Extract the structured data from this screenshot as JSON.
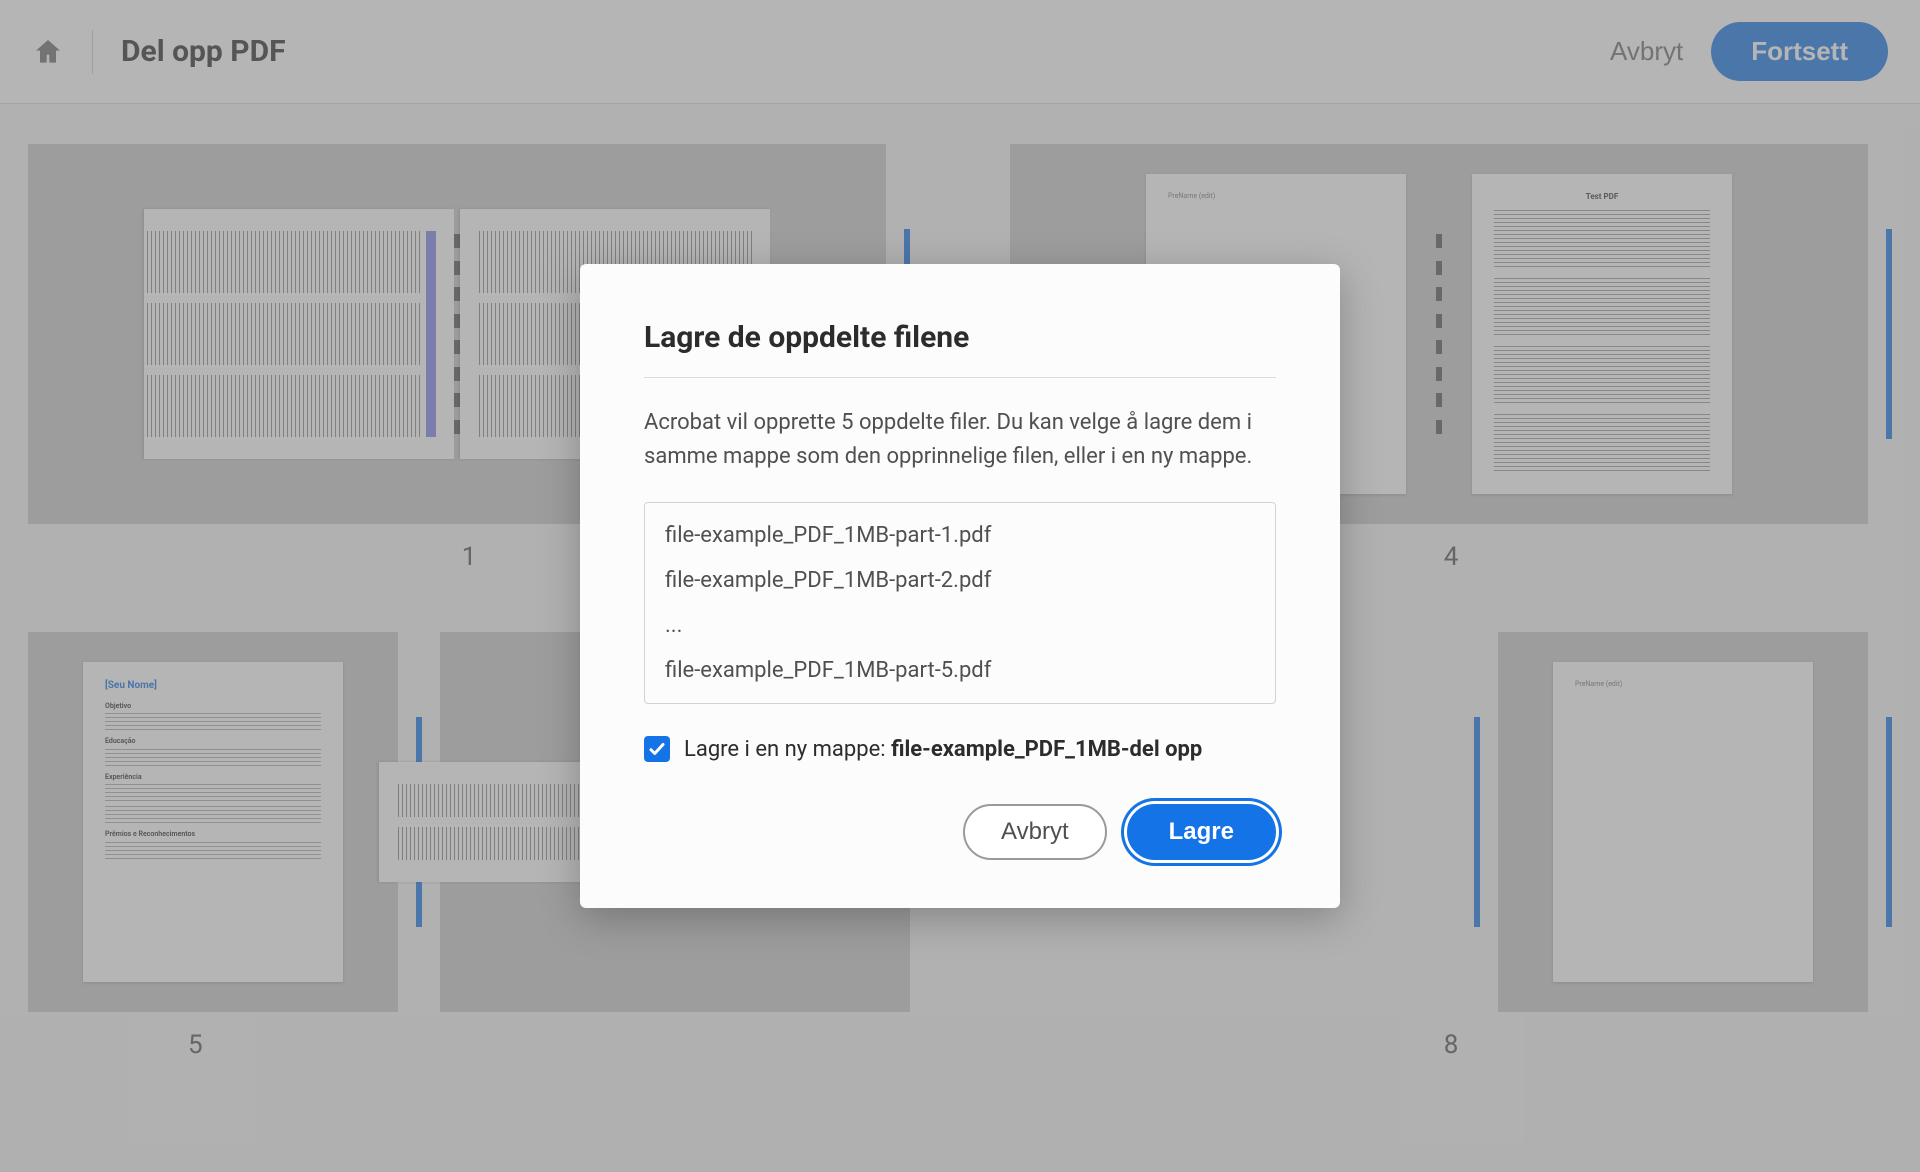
{
  "header": {
    "title": "Del opp PDF",
    "cancel": "Avbryt",
    "continue": "Fortsett"
  },
  "pages": {
    "p1": "1",
    "p4": "4",
    "p5": "5",
    "p8": "8"
  },
  "thumb": {
    "seu_nome": "[Seu Nome]",
    "objetivo": "Objetivo",
    "educacao": "Educação",
    "experiencia": "Experiência",
    "premios": "Prêmios e Reconhecimentos",
    "test_pdf": "Test PDF",
    "prename": "PreName (edit)"
  },
  "modal": {
    "title": "Lagre de oppdelte filene",
    "description": "Acrobat vil opprette 5 oppdelte filer. Du kan velge å lagre dem i samme mappe som den opprinnelige filen, eller i en ny mappe.",
    "files": {
      "f1": "file-example_PDF_1MB-part-1.pdf",
      "f2": "file-example_PDF_1MB-part-2.pdf",
      "ell": "...",
      "f5": "file-example_PDF_1MB-part-5.pdf"
    },
    "check_prefix": "Lagre i en ny mappe: ",
    "check_folder": "file-example_PDF_1MB-del opp",
    "cancel": "Avbryt",
    "save": "Lagre"
  }
}
